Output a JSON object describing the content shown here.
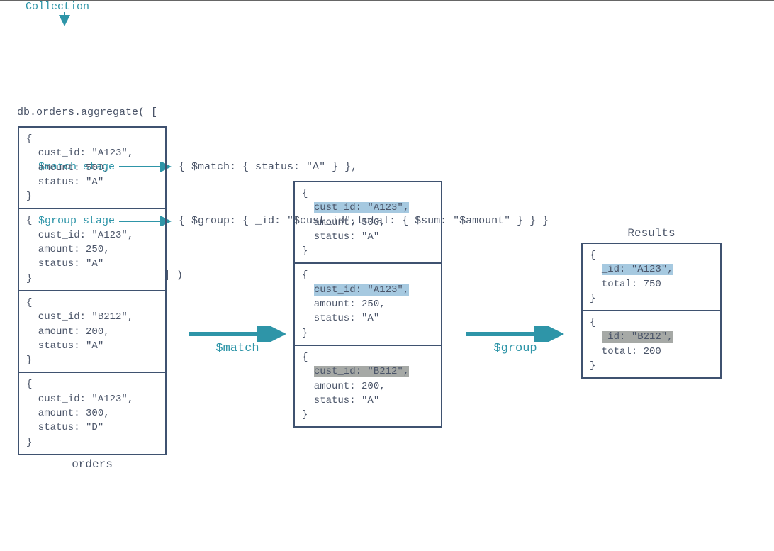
{
  "header": {
    "collection_label": "Collection",
    "line1_pre": "db.orders.aggregate( [",
    "match_stage_label": "$match stage",
    "match_code": "{ $match: { status: \"A\" } },",
    "group_stage_label": "$group stage",
    "group_code": "{ $group: { _id: \"$cust_id\",total: { $sum: \"$amount\" } } }",
    "close": "] )"
  },
  "orders_caption": "orders",
  "results_caption": "Results",
  "flow": {
    "match": "$match",
    "group": "$group"
  },
  "orders": [
    {
      "open": "{",
      "l1": "  cust_id: \"A123\",",
      "l2": "  amount: 500,",
      "l3": "  status: \"A\"",
      "close": "}"
    },
    {
      "open": "{",
      "l1": "  cust_id: \"A123\",",
      "l2": "  amount: 250,",
      "l3": "  status: \"A\"",
      "close": "}"
    },
    {
      "open": "{",
      "l1": "  cust_id: \"B212\",",
      "l2": "  amount: 200,",
      "l3": "  status: \"A\"",
      "close": "}"
    },
    {
      "open": "{",
      "l1": "  cust_id: \"A123\",",
      "l2": "  amount: 300,",
      "l3": "  status: \"D\"",
      "close": "}"
    }
  ],
  "matched": [
    {
      "open": "{",
      "hl": "cust_id: \"A123\",",
      "hl_class": "hl-blue",
      "l2": "  amount: 500,",
      "l3": "  status: \"A\"",
      "close": "}"
    },
    {
      "open": "{",
      "hl": "cust_id: \"A123\",",
      "hl_class": "hl-blue",
      "l2": "  amount: 250,",
      "l3": "  status: \"A\"",
      "close": "}"
    },
    {
      "open": "{",
      "hl": "cust_id: \"B212\",",
      "hl_class": "hl-gray",
      "l2": "  amount: 200,",
      "l3": "  status: \"A\"",
      "close": "}"
    }
  ],
  "results": [
    {
      "open": "{",
      "hl": "_id: \"A123\",",
      "hl_class": "hl-blue",
      "l2": "  total: 750",
      "close": "}"
    },
    {
      "open": "{",
      "hl": "_id: \"B212\",",
      "hl_class": "hl-gray",
      "l2": "  total: 200",
      "close": "}"
    }
  ]
}
